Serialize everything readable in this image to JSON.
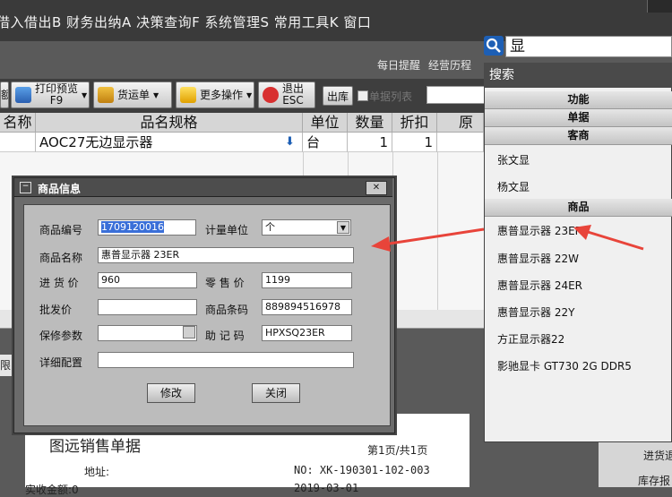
{
  "menubar": {
    "text": "借入借出B 财务出纳A 决策查询F 系统管理S 常用工具K 窗口"
  },
  "toplinks": {
    "daily_reminder": "每日提醒",
    "business_history": "经营历程"
  },
  "toolbar": {
    "partial_left": "额",
    "print_preview": "打印预览",
    "print_key": "F9",
    "waybill": "货运单",
    "more_ops": "更多操作",
    "exit": "退出",
    "exit_key": "ESC",
    "outbound": "出库",
    "bill_list": "单据列表"
  },
  "grid": {
    "headers": [
      "名称",
      "品名规格",
      "单位",
      "数量",
      "折扣",
      "原价"
    ],
    "row": {
      "spec": "AOC27无边显示器",
      "unit": "台",
      "qty": "1",
      "discount": "1"
    }
  },
  "lower": {
    "left_text": "限",
    "doc_title": "图远销售单据",
    "page_info": "第1页/共1页",
    "address_label": "地址:",
    "doc_no": "NO: XK-190301-102-003",
    "partial": "实收金额:0",
    "partial_date": "2019-03-01"
  },
  "dialog": {
    "title": "商品信息",
    "fields": {
      "code_label": "商品编号",
      "code_value": "1709120016",
      "unit_label": "计量单位",
      "unit_value": "个",
      "name_label": "商品名称",
      "name_value": "惠普显示器 23ER",
      "purchase_label": "进 货 价",
      "purchase_value": "960",
      "retail_label": "零 售 价",
      "retail_value": "1199",
      "wholesale_label": "批发价",
      "wholesale_value": "",
      "barcode_label": "商品条码",
      "barcode_value": "889894516978",
      "warranty_label": "保修参数",
      "warranty_value": "",
      "mnemonic_label": "助 记 码",
      "mnemonic_value": "HPXSQ23ER",
      "detail_label": "详细配置",
      "detail_value": ""
    },
    "modify": "修改",
    "close": "关闭"
  },
  "search": {
    "query": "显",
    "panel_title": "搜索",
    "categories": {
      "function": "功能",
      "bill": "单据",
      "customer": "客商",
      "goods": "商品"
    },
    "customers": [
      "张文显",
      "杨文显"
    ],
    "goods": [
      "惠普显示器 23ER",
      "惠普显示器 22W",
      "惠普显示器 24ER",
      "惠普显示器 22Y",
      "方正显示器22",
      "影驰显卡 GT730 2G DDR5"
    ]
  },
  "right_bottom": {
    "line1": "进货退",
    "line2": "库存报"
  },
  "colors": {
    "accent": "#1d5fb5",
    "arrow": "#e8443a",
    "selection": "#3a6fd8"
  }
}
